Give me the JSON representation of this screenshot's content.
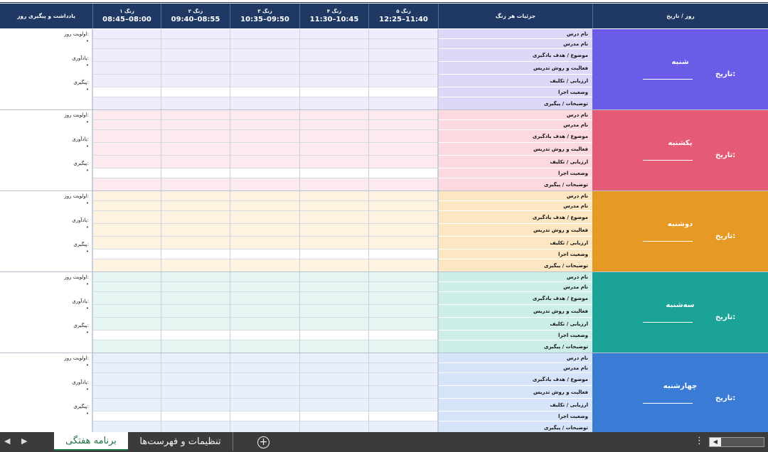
{
  "header": {
    "day_date": "روز / تاریخ",
    "period_details": "جزئیات هر زنگ",
    "notes": "یادداشت و پیگیری روز",
    "periods": [
      {
        "name": "زنگ ۵",
        "time": "12:25–11:40"
      },
      {
        "name": "زنگ ۴",
        "time": "11:30–10:45"
      },
      {
        "name": "زنگ ۳",
        "time": "10:35–09:50"
      },
      {
        "name": "زنگ ۲",
        "time": "09:40–08:55"
      },
      {
        "name": "زنگ ۱",
        "time": "08:45–08:00"
      }
    ]
  },
  "row_labels": [
    "نام درس",
    "نام مدرس",
    "موضوع / هدف یادگیری",
    "فعالیت و روش تدریس",
    "ارزیابی / تکلیف",
    "وضعیت اجرا",
    "توضیحات / پیگیری"
  ],
  "date_label": "تاریخ:",
  "notes_labels": {
    "priority": "اولویت روز:",
    "reminders": "یادآوری:",
    "followup": "پیگیری:",
    "bullet": "•"
  },
  "days": [
    {
      "name": "شنبه",
      "color": "#6b5ce7",
      "label_bg": "#dcd8f8",
      "cell_bg": "#efedfd"
    },
    {
      "name": "یکشنبه",
      "color": "#e55a74",
      "label_bg": "#fbd9df",
      "cell_bg": "#fdeaee"
    },
    {
      "name": "دوشنبه",
      "color": "#e69a24",
      "label_bg": "#fde7c3",
      "cell_bg": "#fef3e0"
    },
    {
      "name": "سه‌شنبه",
      "color": "#1aa396",
      "label_bg": "#cdeee8",
      "cell_bg": "#e6f6f3"
    },
    {
      "name": "چهارشنبه",
      "color": "#3a7bd5",
      "label_bg": "#d6e4f9",
      "cell_bg": "#e9f0fc"
    }
  ],
  "tabs": {
    "active": "برنامه هفتگی",
    "other": "تنظیمات و فهرست‌ها"
  },
  "icons": {
    "add": "+",
    "more": "⋮",
    "left": "◀",
    "prev": "◀",
    "next": "▶"
  }
}
